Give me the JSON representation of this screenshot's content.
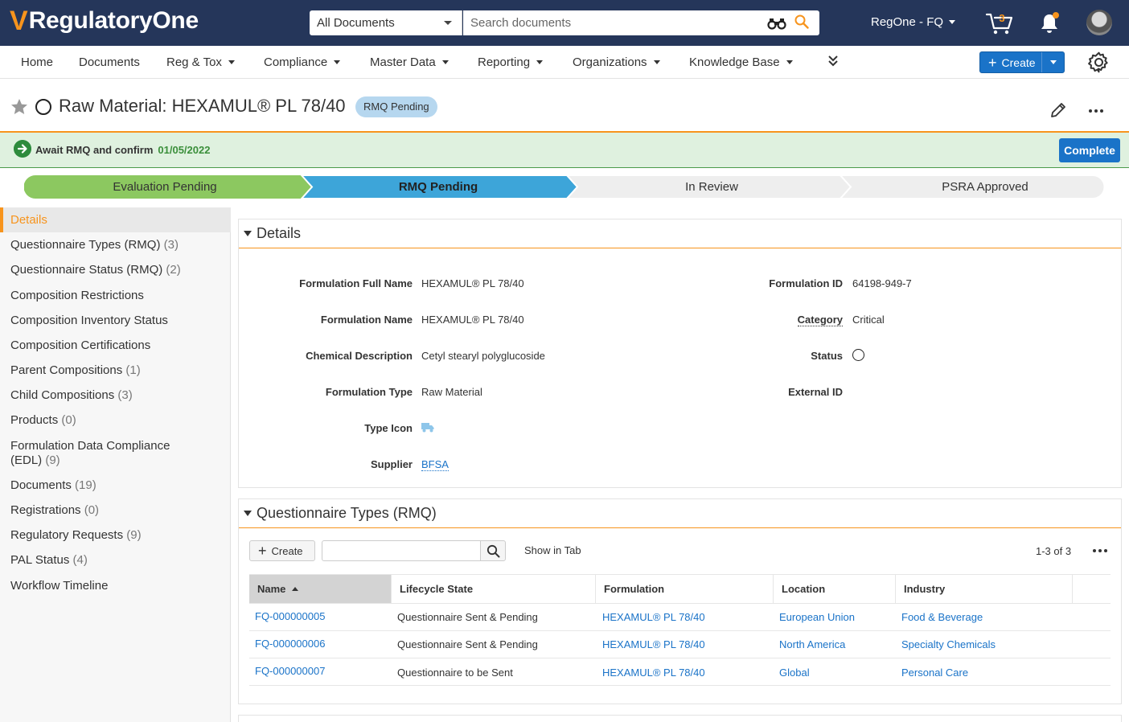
{
  "header": {
    "logo_mark": "V",
    "logo_text": "RegulatoryOne",
    "doc_scope": "All Documents",
    "search_placeholder": "Search documents",
    "user_menu": "RegOne - FQ",
    "cart_count": "3",
    "colors": {
      "bar": "#25365a",
      "accent": "#f7941d",
      "primary": "#1a73c8"
    }
  },
  "nav": {
    "items": [
      "Home",
      "Documents",
      "Reg & Tox",
      "Compliance",
      "Master Data",
      "Reporting",
      "Organizations",
      "Knowledge Base"
    ],
    "create_label": "Create"
  },
  "title": {
    "text": "Raw Material: HEXAMUL® PL 78/40",
    "status": "RMQ Pending"
  },
  "task": {
    "text": "Await RMQ and confirm",
    "date": "01/05/2022",
    "action": "Complete"
  },
  "lifecycle": {
    "stages": [
      {
        "label": "Evaluation Pending",
        "state": "done"
      },
      {
        "label": "RMQ Pending",
        "state": "current"
      },
      {
        "label": "In Review",
        "state": "future"
      },
      {
        "label": "PSRA Approved",
        "state": "future"
      }
    ]
  },
  "sidebar": {
    "items": [
      {
        "label": "Details",
        "count": ""
      },
      {
        "label": "Questionnaire Types (RMQ)",
        "count": "(3)"
      },
      {
        "label": "Questionnaire Status (RMQ)",
        "count": "(2)"
      },
      {
        "label": "Composition Restrictions",
        "count": ""
      },
      {
        "label": "Composition Inventory Status",
        "count": ""
      },
      {
        "label": "Composition Certifications",
        "count": ""
      },
      {
        "label": "Parent Compositions",
        "count": "(1)"
      },
      {
        "label": "Child Compositions",
        "count": "(3)"
      },
      {
        "label": "Products",
        "count": "(0)"
      },
      {
        "label": "Formulation Data Compliance (EDL)",
        "count": "(9)"
      },
      {
        "label": "Documents",
        "count": "(19)"
      },
      {
        "label": "Registrations",
        "count": "(0)"
      },
      {
        "label": "Regulatory Requests",
        "count": "(9)"
      },
      {
        "label": "PAL Status",
        "count": "(4)"
      },
      {
        "label": "Workflow Timeline",
        "count": ""
      }
    ]
  },
  "details": {
    "heading": "Details",
    "left": [
      {
        "label": "Formulation Full Name",
        "value": "HEXAMUL® PL 78/40"
      },
      {
        "label": "Formulation Name",
        "value": "HEXAMUL® PL 78/40"
      },
      {
        "label": "Chemical Description",
        "value": "Cetyl stearyl polyglucoside"
      },
      {
        "label": "Formulation Type",
        "value": "Raw Material"
      },
      {
        "label": "Type Icon",
        "value": ""
      },
      {
        "label": "Supplier",
        "value": "BFSA"
      }
    ],
    "right": [
      {
        "label": "Formulation ID",
        "value": "64198-949-7"
      },
      {
        "label": "Category",
        "value": "Critical"
      },
      {
        "label": "Status",
        "value": ""
      },
      {
        "label": "External ID",
        "value": ""
      }
    ]
  },
  "questionnaires": {
    "heading": "Questionnaire Types (RMQ)",
    "create_label": "Create",
    "show_in_tab": "Show in Tab",
    "paging": "1-3 of 3",
    "columns": [
      "Name",
      "Lifecycle State",
      "Formulation",
      "Location",
      "Industry"
    ],
    "rows": [
      {
        "name": "FQ-000000005",
        "state": "Questionnaire Sent & Pending",
        "formulation": "HEXAMUL® PL 78/40",
        "location": "European Union",
        "industry": "Food & Beverage"
      },
      {
        "name": "FQ-000000006",
        "state": "Questionnaire Sent & Pending",
        "formulation": "HEXAMUL® PL 78/40",
        "location": "North America",
        "industry": "Specialty Chemicals"
      },
      {
        "name": "FQ-000000007",
        "state": "Questionnaire to be Sent",
        "formulation": "HEXAMUL® PL 78/40",
        "location": "Global",
        "industry": "Personal Care"
      }
    ]
  }
}
